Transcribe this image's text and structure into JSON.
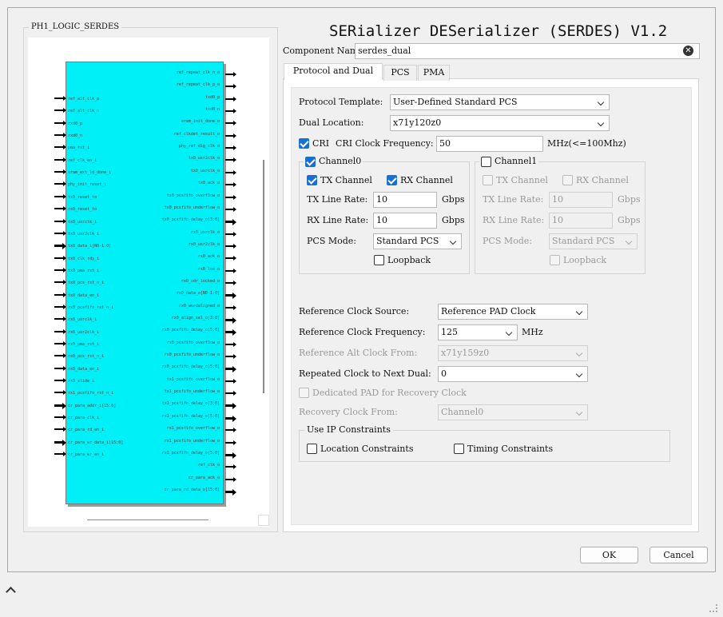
{
  "dialog_title": "SERializer DESerializer (SERDES) V1.2",
  "symbol_panel": {
    "group_title": "PH1_LOGIC_SERDES",
    "left_pins": [
      {
        "label": "ref_alt_clk_p",
        "bus": false
      },
      {
        "label": "ref_alt_clk_n",
        "bus": false
      },
      {
        "label": "rxd0_p",
        "bus": false
      },
      {
        "label": "rxd0_n",
        "bus": false
      },
      {
        "label": "pma_rst_i",
        "bus": false
      },
      {
        "label": "ref_clk_en_i",
        "bus": false
      },
      {
        "label": "sram_ext_ld_done_i",
        "bus": false
      },
      {
        "label": "phy_init_reset_i",
        "bus": false
      },
      {
        "label": "tx0_reset_to",
        "bus": false
      },
      {
        "label": "rx0_reset_to",
        "bus": false
      },
      {
        "label": "tx0_usrclk_i",
        "bus": false
      },
      {
        "label": "tx0_usr2clk_i",
        "bus": false
      },
      {
        "label": "tx0_data_i[N0-1:0]",
        "bus": true
      },
      {
        "label": "tx0_clk_rdy_i",
        "bus": false
      },
      {
        "label": "tx0_pma_rst_i",
        "bus": false
      },
      {
        "label": "tx0_pcs_rst_n_i",
        "bus": false
      },
      {
        "label": "tx0_data_en_i",
        "bus": false
      },
      {
        "label": "rx0_pcsfifo_rst_n_i",
        "bus": false
      },
      {
        "label": "rx0_usrclk_i",
        "bus": false
      },
      {
        "label": "rx0_usr2clk_i",
        "bus": false
      },
      {
        "label": "rx0_pma_rst_i",
        "bus": false
      },
      {
        "label": "rx0_pcs_rst_n_i",
        "bus": false
      },
      {
        "label": "rx0_data_en_i",
        "bus": false
      },
      {
        "label": "rx0_slide_i",
        "bus": false
      },
      {
        "label": "rx1_pcsfifo_rst_n_i",
        "bus": false
      },
      {
        "label": "cr_para_addr_i[15:0]",
        "bus": true
      },
      {
        "label": "cr_para_clk_i",
        "bus": false
      },
      {
        "label": "cr_para_rd_en_i",
        "bus": false
      },
      {
        "label": "cr_para_wr_data_i[15:0]",
        "bus": true
      },
      {
        "label": "cr_para_wr_en_i",
        "bus": false
      }
    ],
    "right_pins": [
      {
        "label": "ref_repeat_clk_n_o",
        "bus": false
      },
      {
        "label": "ref_repeat_clk_p_o",
        "bus": false
      },
      {
        "label": "txd0_p",
        "bus": false
      },
      {
        "label": "txd0_n",
        "bus": false
      },
      {
        "label": "sram_init_done_o",
        "bus": false
      },
      {
        "label": "ref_clkdet_result_o",
        "bus": false
      },
      {
        "label": "phy_ref_dig_clk_o",
        "bus": false
      },
      {
        "label": "tx0_usr2clk_o",
        "bus": false
      },
      {
        "label": "tx0_usrclk_o",
        "bus": false
      },
      {
        "label": "tx0_ack_o",
        "bus": false
      },
      {
        "label": "tx0_pcsfifo_overflow_o",
        "bus": false
      },
      {
        "label": "tx0_pcsfifo_underflow_o",
        "bus": false
      },
      {
        "label": "tx0_pcsfifo_delay_o[3:0]",
        "bus": true
      },
      {
        "label": "rx0_usrclk_o",
        "bus": false
      },
      {
        "label": "rx0_usr2clk_o",
        "bus": false
      },
      {
        "label": "rx0_ack_o",
        "bus": false
      },
      {
        "label": "rx0_los_o",
        "bus": false
      },
      {
        "label": "rx0_cdr_locked_o",
        "bus": false
      },
      {
        "label": "rx0_data_o[N0-1:0]",
        "bus": true
      },
      {
        "label": "rx0_wordaligned_o",
        "bus": false
      },
      {
        "label": "rx0_align_sel_o[3:0]",
        "bus": true
      },
      {
        "label": "rx0_pcsfifo_delay_o[5:0]",
        "bus": true
      },
      {
        "label": "rx0_pcsfifo_overflow_o",
        "bus": false
      },
      {
        "label": "rx0_pcsfifo_underflow_o",
        "bus": false
      },
      {
        "label": "rx0_pcsfifo_delay_o[5:0]",
        "bus": true
      },
      {
        "label": "tx1_pcsfifo_overflow_o",
        "bus": false
      },
      {
        "label": "tx1_pcsfifo_underflow_o",
        "bus": false
      },
      {
        "label": "tx1_pcsfifo_delay_o[3:0]",
        "bus": true
      },
      {
        "label": "rx1_pcsfifo_delay_o[5:0]",
        "bus": true
      },
      {
        "label": "rx1_pcsfifo_overflow_o",
        "bus": false
      },
      {
        "label": "rx1_pcsfifo_underflow_o",
        "bus": false
      },
      {
        "label": "rx1_pcsfifo_delay_o[5:0]",
        "bus": true
      },
      {
        "label": "ref_clk_o",
        "bus": false
      },
      {
        "label": "cr_para_ack_o",
        "bus": false
      },
      {
        "label": "cr_para_rd_data_o[15:0]",
        "bus": true
      }
    ]
  },
  "component_name": {
    "label": "Component Name",
    "value": "serdes_dual"
  },
  "tabs": [
    "Protocol and Dual",
    "PCS",
    "PMA"
  ],
  "protocol": {
    "template_label": "Protocol Template:",
    "template_value": "User-Defined Standard PCS",
    "location_label": "Dual Location:",
    "location_value": "x71y120z0",
    "cri_label": "CRI",
    "cri_freq_label": "CRI Clock Frequency:",
    "cri_freq_value": "50",
    "cri_freq_unit": "MHz(<=100Mhz)"
  },
  "channel0": {
    "title": "Channel0",
    "tx_label": "TX Channel",
    "rx_label": "RX Channel",
    "tx_rate_label": "TX Line Rate:",
    "tx_rate_value": "10",
    "rx_rate_label": "RX Line Rate:",
    "rx_rate_value": "10",
    "unit": "Gbps",
    "pcs_label": "PCS Mode:",
    "pcs_value": "Standard PCS",
    "loopback_label": "Loopback"
  },
  "channel1": {
    "title": "Channel1",
    "tx_label": "TX Channel",
    "rx_label": "RX Channel",
    "tx_rate_label": "TX Line Rate:",
    "tx_rate_value": "10",
    "rx_rate_label": "RX Line Rate:",
    "rx_rate_value": "10",
    "unit": "Gbps",
    "pcs_label": "PCS Mode:",
    "pcs_value": "Standard PCS",
    "loopback_label": "Loopback"
  },
  "clock": {
    "ref_src_label": "Reference Clock Source:",
    "ref_src_value": "Reference PAD Clock",
    "ref_freq_label": "Reference Clock Frequency:",
    "ref_freq_value": "125",
    "ref_freq_unit": "MHz",
    "alt_from_label": "Reference Alt Clock From:",
    "alt_from_value": "x71y159z0",
    "repeat_label": "Repeated Clock to Next Dual:",
    "repeat_value": "0",
    "dedicated_label": "Dedicated PAD for Recovery Clock",
    "recovery_label": "Recovery Clock From:",
    "recovery_value": "Channel0"
  },
  "ip_constraints": {
    "title": "Use IP Constraints",
    "location_label": "Location Constraints",
    "timing_label": "Timing Constraints"
  },
  "buttons": {
    "ok": "OK",
    "cancel": "Cancel"
  }
}
